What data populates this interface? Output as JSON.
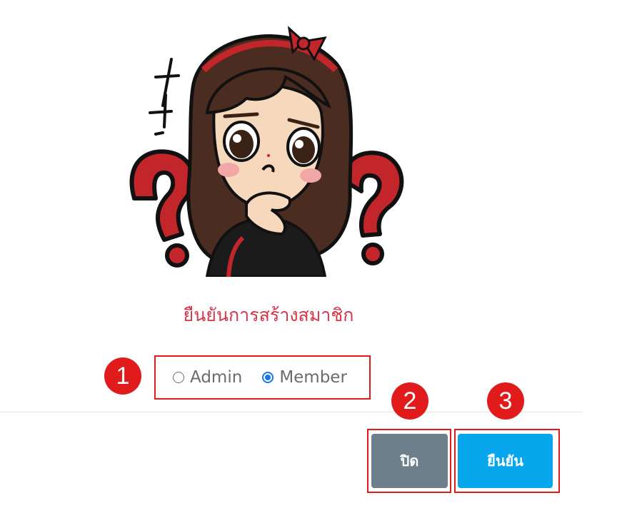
{
  "dialog": {
    "title": "ยืนยันการสร้างสมาชิก",
    "role_options": [
      {
        "label": "Admin",
        "selected": false
      },
      {
        "label": "Member",
        "selected": true
      }
    ],
    "close_label": "ปิด",
    "confirm_label": "ยืนยัน"
  },
  "annotations": {
    "badge_1": "1",
    "badge_2": "2",
    "badge_3": "3"
  },
  "colors": {
    "title": "#d7354a",
    "annotation": "#e11b1b",
    "close_button": "#6c7f8b",
    "confirm_button": "#08a6ec",
    "radio_checked": "#1976f2"
  },
  "illustration": {
    "icon": "confused-girl-sticker"
  }
}
